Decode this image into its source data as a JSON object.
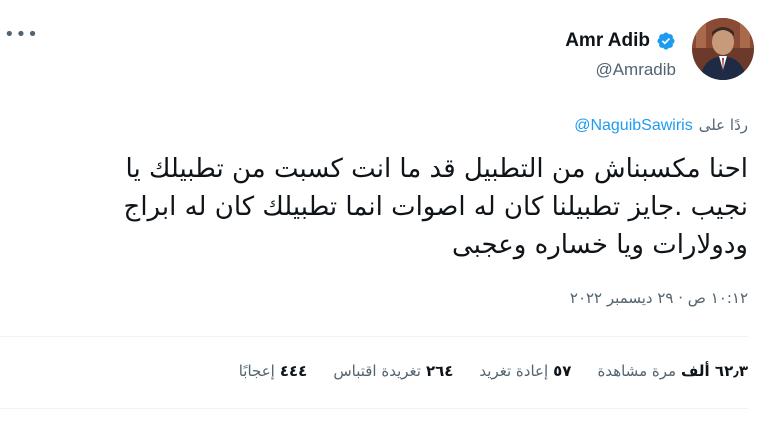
{
  "author": {
    "name": "Amr Adib",
    "handle": "@Amradib"
  },
  "reply": {
    "prefix": "ردًا على",
    "mention": "@NaguibSawiris"
  },
  "tweet": {
    "text": "احنا مكسبناش من التطبيل قد ما انت كسبت من تطبيلك يا\nنجيب .جايز تطبيلنا كان له اصوات انما تطبيلك كان له ابراج\nودولارات ويا خساره وعجبى"
  },
  "meta": {
    "timestamp": "١٠:١٢ ص · ٢٩ ديسمبر ٢٠٢٢"
  },
  "stats": {
    "views_value": "٦٢٫٣ ألف",
    "views_label": "مرة مشاهدة",
    "retweets_value": "٥٧",
    "retweets_label": "إعادة تغريد",
    "quotes_value": "٢٦٤",
    "quotes_label": "تغريدة اقتباس",
    "likes_value": "٤٤٤",
    "likes_label": "إعجابًا"
  },
  "colors": {
    "accent": "#1d9bf0",
    "secondary_text": "#536471",
    "divider": "#eff3f4"
  },
  "icons": {
    "more": "more-horizontal-icon",
    "verified": "verified-badge-icon"
  }
}
